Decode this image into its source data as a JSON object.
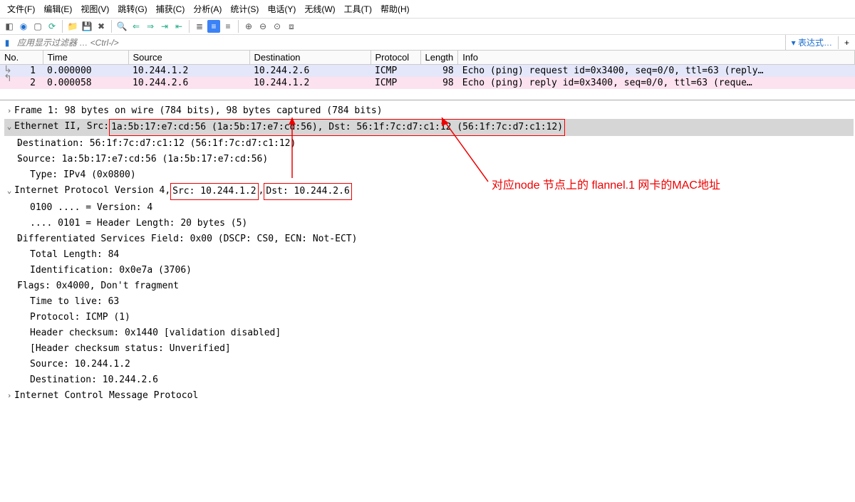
{
  "menu": [
    "文件(F)",
    "编辑(E)",
    "视图(V)",
    "跳转(G)",
    "捕获(C)",
    "分析(A)",
    "统计(S)",
    "电话(Y)",
    "无线(W)",
    "工具(T)",
    "帮助(H)"
  ],
  "filter": {
    "placeholder": "应用显示过滤器 … <Ctrl-/>",
    "expr_label": "表达式…",
    "plus": "+"
  },
  "columns": [
    "No.",
    "Time",
    "Source",
    "Destination",
    "Protocol",
    "Length",
    "Info"
  ],
  "packets": [
    {
      "no": "1",
      "time": "0.000000",
      "src": "10.244.1.2",
      "dst": "10.244.2.6",
      "proto": "ICMP",
      "len": "98",
      "info": "Echo (ping) request  id=0x3400, seq=0/0, ttl=63 (reply…",
      "cls": "row-sel1"
    },
    {
      "no": "2",
      "time": "0.000058",
      "src": "10.244.2.6",
      "dst": "10.244.1.2",
      "proto": "ICMP",
      "len": "98",
      "info": "Echo (ping) reply    id=0x3400, seq=0/0, ttl=63 (reque…",
      "cls": "row-sel2"
    }
  ],
  "details": {
    "frame": "Frame 1: 98 bytes on wire (784 bits), 98 bytes captured (784 bits)",
    "eth_prefix": "Ethernet II, Src: ",
    "eth_box": "1a:5b:17:e7:cd:56 (1a:5b:17:e7:cd:56), Dst: 56:1f:7c:d7:c1:12 (56:1f:7c:d7:c1:12)",
    "eth_dst": "Destination: 56:1f:7c:d7:c1:12 (56:1f:7c:d7:c1:12)",
    "eth_src": "Source: 1a:5b:17:e7:cd:56 (1a:5b:17:e7:cd:56)",
    "eth_type": "Type: IPv4 (0x0800)",
    "ip_prefix": "Internet Protocol Version 4, ",
    "ip_srcbox": "Src: 10.244.1.2",
    "ip_mid": ", ",
    "ip_dstbox": "Dst: 10.244.2.6",
    "ip_ver": "0100 .... = Version: 4",
    "ip_hlen": ".... 0101 = Header Length: 20 bytes (5)",
    "ip_dscp": "Differentiated Services Field: 0x00 (DSCP: CS0, ECN: Not-ECT)",
    "ip_tlen": "Total Length: 84",
    "ip_id": "Identification: 0x0e7a (3706)",
    "ip_flags": "Flags: 0x4000, Don't fragment",
    "ip_ttl": "Time to live: 63",
    "ip_proto": "Protocol: ICMP (1)",
    "ip_cksum": "Header checksum: 0x1440 [validation disabled]",
    "ip_cksum_s": "[Header checksum status: Unverified]",
    "ip_srcl": "Source: 10.244.1.2",
    "ip_dstl": "Destination: 10.244.2.6",
    "icmp": "Internet Control Message Protocol"
  },
  "annotation": "对应node 节点上的 flannel.1 网卡的MAC地址"
}
